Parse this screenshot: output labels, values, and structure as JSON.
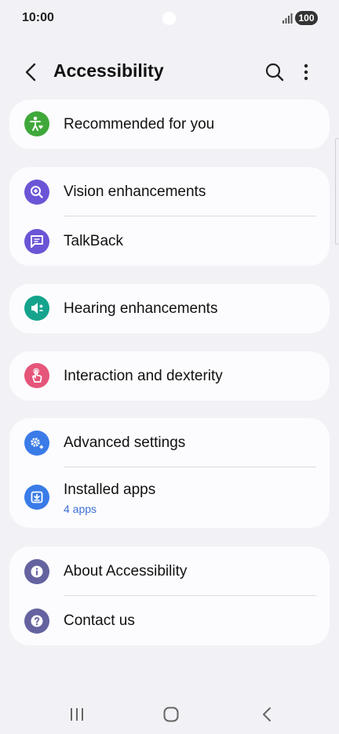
{
  "status_bar": {
    "time": "10:00",
    "battery": "100"
  },
  "header": {
    "title": "Accessibility"
  },
  "cards": [
    {
      "items": [
        {
          "label": "Recommended for you",
          "icon": "accessibility-person-icon",
          "color": "#3fa83a"
        }
      ]
    },
    {
      "items": [
        {
          "label": "Vision enhancements",
          "icon": "magnifier-plus-icon",
          "color": "#6b55d6"
        },
        {
          "label": "TalkBack",
          "icon": "speech-bubble-icon",
          "color": "#6b55d6"
        }
      ]
    },
    {
      "items": [
        {
          "label": "Hearing enhancements",
          "icon": "speaker-icon",
          "color": "#15a38d"
        }
      ]
    },
    {
      "items": [
        {
          "label": "Interaction and dexterity",
          "icon": "hand-pointer-icon",
          "color": "#e6557a"
        }
      ]
    },
    {
      "items": [
        {
          "label": "Advanced settings",
          "icon": "gears-plus-icon",
          "color": "#3a7be8"
        },
        {
          "label": "Installed apps",
          "sublabel": "4 apps",
          "icon": "download-box-icon",
          "color": "#3a7be8"
        }
      ]
    },
    {
      "items": [
        {
          "label": "About Accessibility",
          "icon": "info-icon",
          "color": "#6463a0"
        },
        {
          "label": "Contact us",
          "icon": "question-icon",
          "color": "#6463a0"
        }
      ]
    }
  ]
}
